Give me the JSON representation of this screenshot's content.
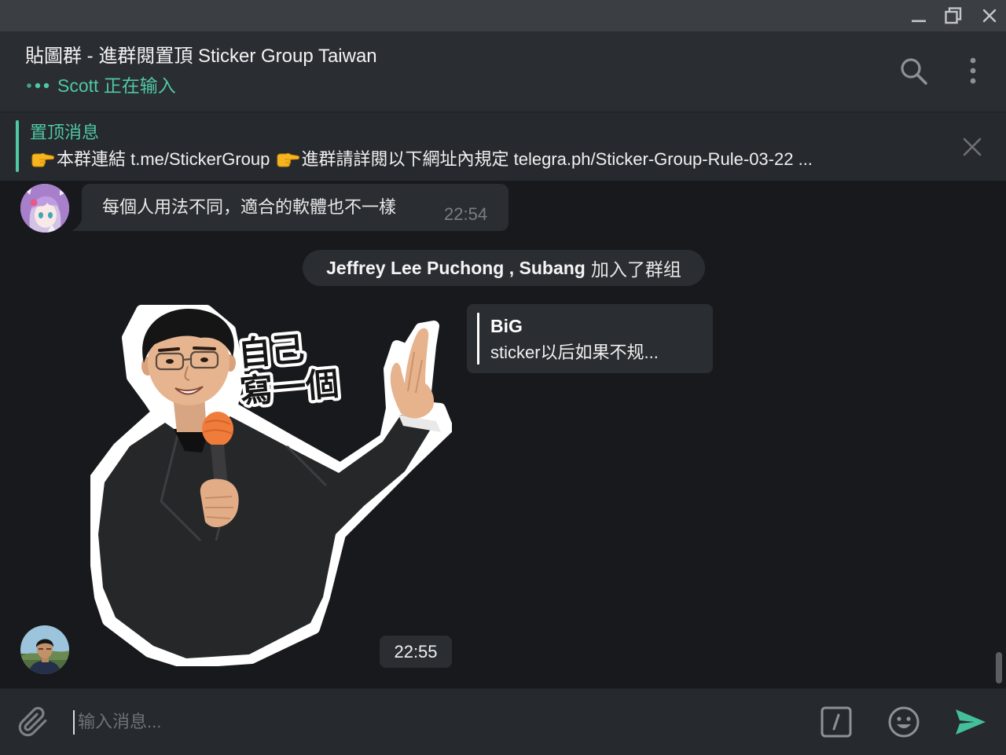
{
  "colors": {
    "accent": "#4fc8a4",
    "send": "#45be9c",
    "chat_background": "#18191c",
    "bubble": "#2a2d32",
    "header": "#2a2d32"
  },
  "window_controls": {
    "minimize_icon": "minimize-icon",
    "restore_icon": "restore-icon",
    "close_icon": "close-icon"
  },
  "header": {
    "title": "貼圖群 - 進群閱置頂 Sticker Group Taiwan",
    "status": "Scott 正在输入",
    "status_icon": "typing-dots-icon",
    "search_icon": "search-icon",
    "menu_icon": "more-vertical-icon"
  },
  "pinned": {
    "label": "置顶消息",
    "parts": [
      {
        "icon": "pointing-right-emoji-icon",
        "text": "本群連結 t.me/StickerGroup "
      },
      {
        "icon": "pointing-right-emoji-icon",
        "text": "進群請詳閱以下網址內規定 telegra.ph/Sticker-Group-Rule-03-22 ..."
      }
    ],
    "close_icon": "close-icon"
  },
  "messages": [
    {
      "avatar_icon": "anime-girl-avatar",
      "text": "每個人用法不同，適合的軟體也不一樣",
      "time": "22:54"
    },
    {
      "actor": "Jeffrey Lee Puchong , Subang",
      "action": "加入了群组"
    },
    {
      "avatar_icon": "young-man-avatar",
      "reply": {
        "author": "BiG",
        "text": "sticker以后如果不规..."
      },
      "sticker": {
        "lettering": [
          "自己",
          "寫一個"
        ]
      },
      "time": "22:55"
    }
  ],
  "composer": {
    "placeholder": "输入消息...",
    "attach_icon": "paperclip-icon",
    "commands_icon": "slash-command-icon",
    "emoji_icon": "smiley-icon",
    "send_icon": "send-icon"
  }
}
